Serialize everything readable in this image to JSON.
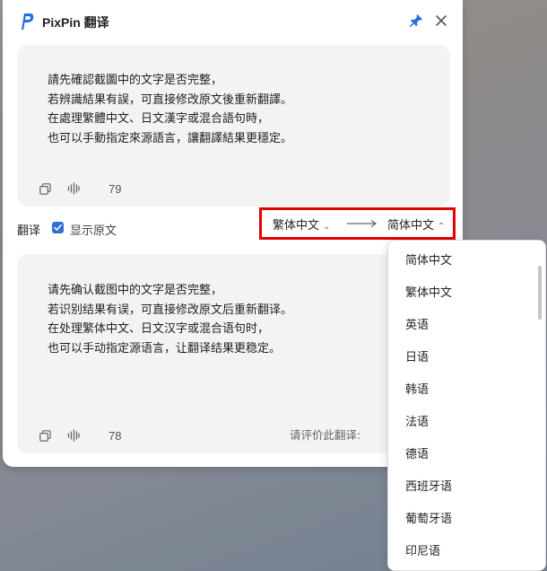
{
  "app": {
    "title": "PixPin 翻译"
  },
  "source": {
    "lines": [
      "請先確認截圖中的文字是否完整，",
      "若辨識結果有誤，可直接修改原文後重新翻譯。",
      "在處理繁體中文、日文漢字或混合語句時，",
      "也可以手動指定來源語言，讓翻譯結果更穩定。"
    ],
    "char_count": "79"
  },
  "toolbar": {
    "translate_label": "翻译",
    "show_original_label": "显示原文",
    "show_original_checked": true,
    "source_lang": "繁体中文",
    "target_lang": "简体中文"
  },
  "target": {
    "lines": [
      "请先确认截图中的文字是否完整，",
      "若识别结果有误，可直接修改原文后重新翻译。",
      "在处理繁体中文、日文汉字或混合语句时，",
      "也可以手动指定源语言，让翻译结果更稳定。"
    ],
    "char_count": "78",
    "rate_label": "请评价此翻译:"
  },
  "dropdown": {
    "options": [
      "简体中文",
      "繁体中文",
      "英语",
      "日语",
      "韩语",
      "法语",
      "德语",
      "西班牙语",
      "葡萄牙语",
      "印尼语"
    ]
  },
  "colors": {
    "accent": "#2f6fd6",
    "highlight_border": "#e00000"
  },
  "icons": [
    "pixpin-logo-icon",
    "pin-icon",
    "close-icon",
    "copy-icon",
    "audio-wave-icon",
    "long-arrow-icon",
    "chevron-down-icon",
    "chevron-up-icon",
    "check-icon"
  ]
}
